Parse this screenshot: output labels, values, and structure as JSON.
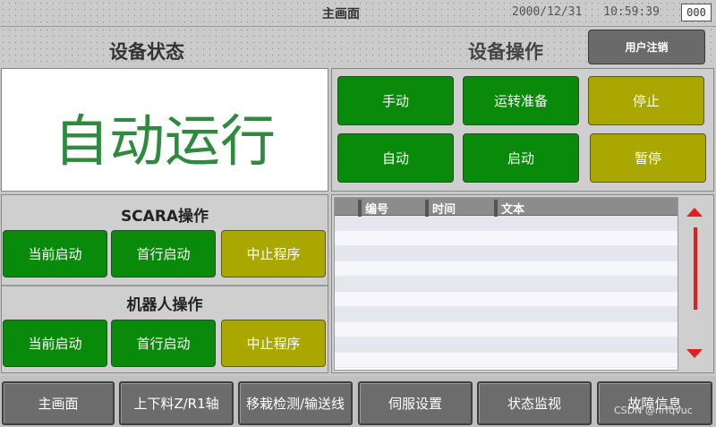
{
  "titlebar": {
    "screen_title": "主画面",
    "date": "2000/12/31",
    "time": "10:59:39",
    "counter": "000"
  },
  "header": {
    "device_status": "设备状态",
    "device_operation": "设备操作",
    "logout": "用户注销"
  },
  "status": {
    "text": "自动运行",
    "color": "#2d8a3e"
  },
  "device_ops": {
    "manual": "手动",
    "ready": "运转准备",
    "stop": "停止",
    "auto": "自动",
    "start": "启动",
    "pause": "暂停"
  },
  "scara": {
    "title": "SCARA操作",
    "current_start": "当前启动",
    "first_line_start": "首行启动",
    "abort_program": "中止程序"
  },
  "robot": {
    "title": "机器人操作",
    "current_start": "当前启动",
    "first_line_start": "首行启动",
    "abort_program": "中止程序"
  },
  "log": {
    "columns": [
      "编号",
      "时间",
      "文本"
    ]
  },
  "nav": {
    "main": "主画面",
    "loading_axis": "上下料Z/R1轴",
    "transplant": "移栽检测/输送线",
    "servo": "伺服设置",
    "monitor": "状态监视",
    "fault": "故障信息"
  },
  "watermark": "CSDN @nrfqvuc",
  "colors": {
    "green_button": "#0a8a0a",
    "olive_button": "#aaa800",
    "scroll_red": "#e02020"
  }
}
